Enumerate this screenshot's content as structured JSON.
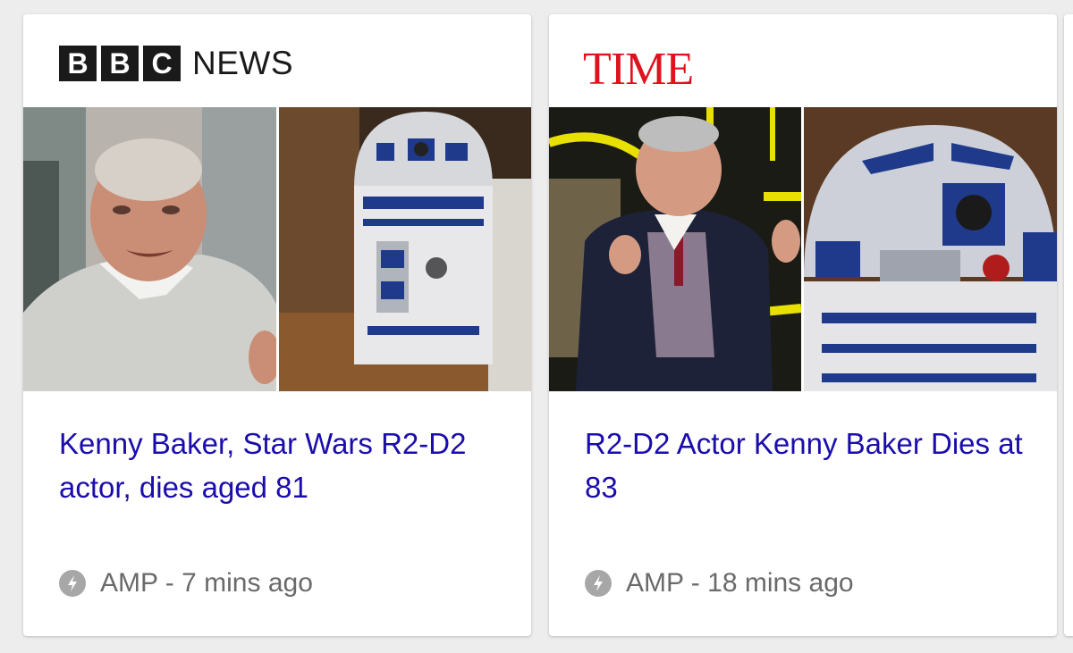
{
  "colors": {
    "headline": "#1a0dab",
    "meta": "#6a6a6a",
    "time_red": "#e0121e",
    "background": "#ededed"
  },
  "cards": [
    {
      "publisher": {
        "logo_letters": [
          "B",
          "B",
          "C"
        ],
        "logo_word": "NEWS"
      },
      "headline": "Kenny Baker, Star Wars R2-D2 actor, dies aged 81",
      "meta": {
        "icon": "amp-lightning-icon",
        "text": "AMP - 7 mins ago"
      }
    },
    {
      "publisher": {
        "logo_word": "TIME"
      },
      "headline": "R2-D2 Actor Kenny Baker Dies at 83",
      "meta": {
        "icon": "amp-lightning-icon",
        "text": "AMP - 18 mins ago"
      }
    }
  ]
}
